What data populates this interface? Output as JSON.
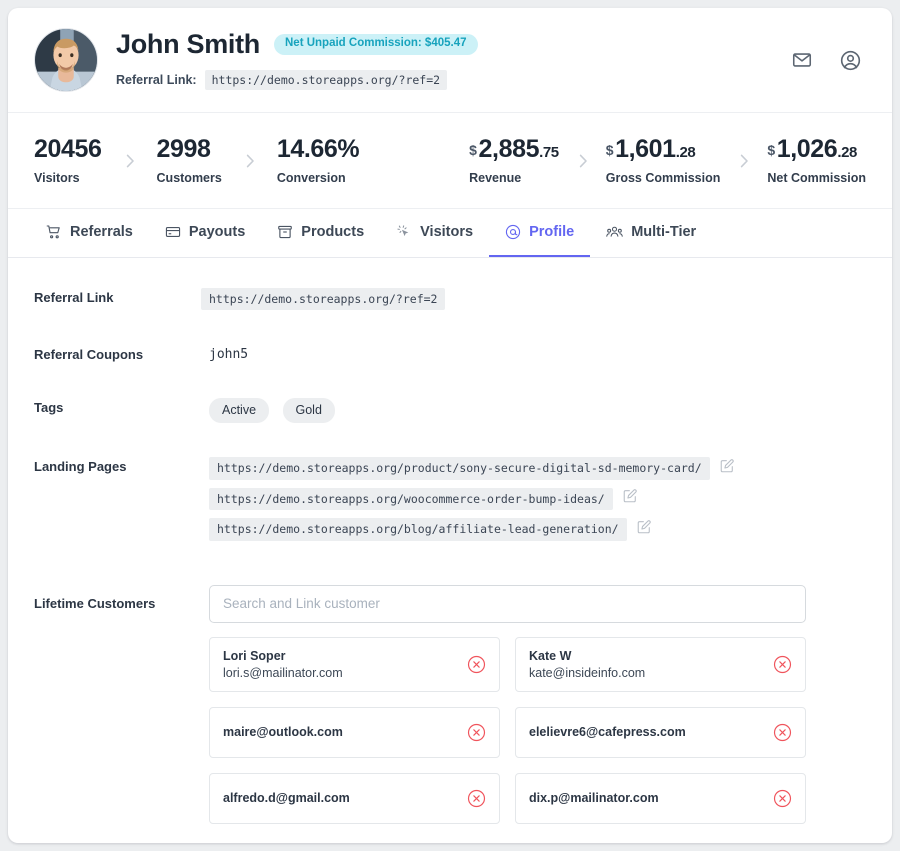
{
  "header": {
    "name": "John Smith",
    "badge": "Net Unpaid Commission: $405.47",
    "referral_label": "Referral Link:",
    "referral_link": "https://demo.storeapps.org/?ref=2",
    "icons": {
      "mail": "mail-icon",
      "account": "account-circle-icon"
    },
    "badge_bg": "#ccf1f7",
    "badge_fg": "#17a3bd"
  },
  "stats": [
    {
      "value": "20456",
      "currency": "",
      "decimals": "",
      "label": "Visitors"
    },
    {
      "value": "2998",
      "currency": "",
      "decimals": "",
      "label": "Customers"
    },
    {
      "value": "14.66%",
      "currency": "",
      "decimals": "",
      "label": "Conversion"
    },
    {
      "value": "2,885",
      "currency": "$",
      "decimals": ".75",
      "label": "Revenue"
    },
    {
      "value": "1,601",
      "currency": "$",
      "decimals": ".28",
      "label": "Gross Commission"
    },
    {
      "value": "1,026",
      "currency": "$",
      "decimals": ".28",
      "label": "Net Commission"
    }
  ],
  "tabs": [
    {
      "label": "Referrals",
      "icon": "cart-icon",
      "active": false
    },
    {
      "label": "Payouts",
      "icon": "card-icon",
      "active": false
    },
    {
      "label": "Products",
      "icon": "box-icon",
      "active": false
    },
    {
      "label": "Visitors",
      "icon": "cursor-click-icon",
      "active": false
    },
    {
      "label": "Profile",
      "icon": "at-circle-icon",
      "active": true
    },
    {
      "label": "Multi-Tier",
      "icon": "people-icon",
      "active": false
    }
  ],
  "accent_color": "#6366f1",
  "profile": {
    "referral_link_label": "Referral Link",
    "referral_link_value": "https://demo.storeapps.org/?ref=2",
    "referral_coupons_label": "Referral Coupons",
    "referral_coupons_value": "john5",
    "tags_label": "Tags",
    "tags": [
      "Active",
      "Gold"
    ],
    "landing_pages_label": "Landing Pages",
    "landing_pages": [
      "https://demo.storeapps.org/product/sony-secure-digital-sd-memory-card/",
      "https://demo.storeapps.org/woocommerce-order-bump-ideas/",
      "https://demo.storeapps.org/blog/affiliate-lead-generation/"
    ],
    "lifetime_customers_label": "Lifetime Customers",
    "search_placeholder": "Search and Link customer",
    "search_value": "",
    "customers": [
      {
        "name": "Lori Soper",
        "email": "lori.s@mailinator.com"
      },
      {
        "name": "Kate W",
        "email": "kate@insideinfo.com"
      },
      {
        "name": "",
        "email": "maire@outlook.com"
      },
      {
        "name": "",
        "email": "elelievre6@cafepress.com"
      },
      {
        "name": "",
        "email": "alfredo.d@gmail.com"
      },
      {
        "name": "",
        "email": "dix.p@mailinator.com"
      }
    ],
    "remove_icon": "remove-circle-icon",
    "edit_icon": "edit-square-icon",
    "remove_color": "#f0545c"
  }
}
